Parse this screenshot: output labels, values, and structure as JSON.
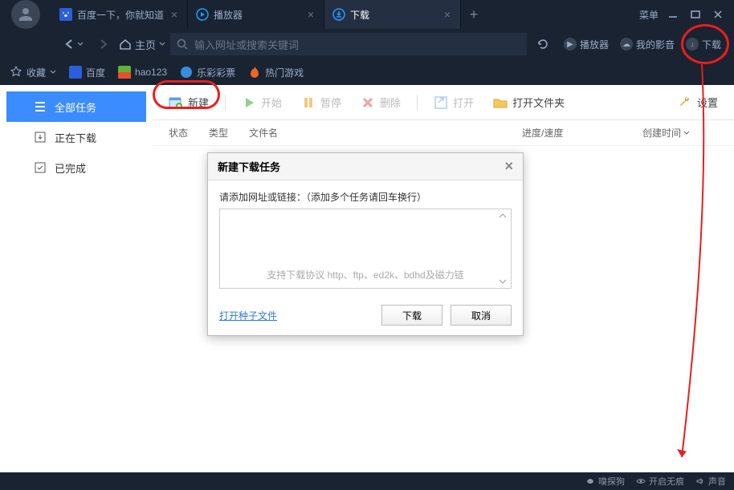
{
  "titlebar": {
    "tabs": [
      {
        "label": "百度一下，你就知道",
        "active": false
      },
      {
        "label": "播放器",
        "active": false
      },
      {
        "label": "下载",
        "active": true
      }
    ],
    "menu": "菜单"
  },
  "navbar": {
    "home": "主页",
    "placeholder": "输入网址或搜索关键词",
    "player": "播放器",
    "myvideo": "我的影音",
    "download": "下载"
  },
  "bookmarks": {
    "fav": "收藏",
    "baidu": "百度",
    "hao123": "hao123",
    "lottery": "乐彩彩票",
    "games": "热门游戏"
  },
  "leftnav": {
    "all": "全部任务",
    "downloading": "正在下载",
    "done": "已完成"
  },
  "toolbar": {
    "new": "新建",
    "start": "开始",
    "pause": "暂停",
    "delete": "删除",
    "open": "打开",
    "folder": "打开文件夹",
    "settings": "设置"
  },
  "columns": {
    "status": "状态",
    "type": "类型",
    "name": "文件名",
    "progress": "进度/速度",
    "time": "创建时间"
  },
  "dialog": {
    "title": "新建下载任务",
    "label": "请添加网址或链接：（添加多个任务请回车换行）",
    "placeholder": "支持下载协议 http、ftp、ed2k、bdhd及磁力链",
    "seed": "打开种子文件",
    "download": "下载",
    "cancel": "取消"
  },
  "statusbar": {
    "sniff": "嗅探狗",
    "private": "开启无痕",
    "sound": "声音"
  }
}
